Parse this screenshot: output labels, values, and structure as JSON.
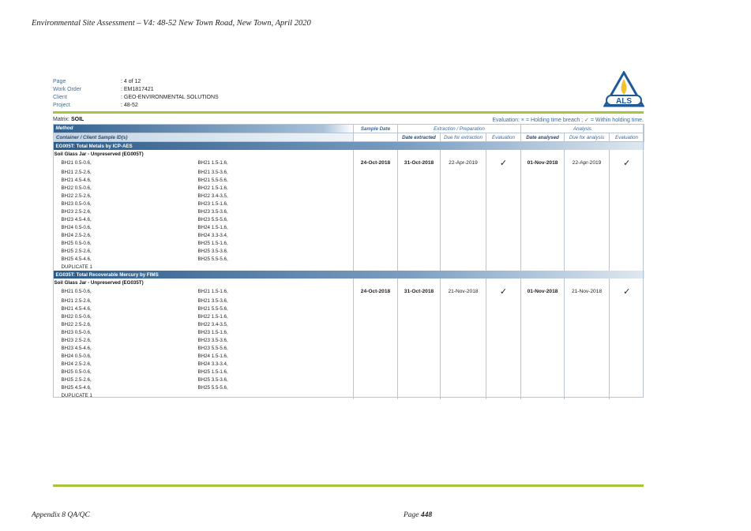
{
  "doc_header": "Environmental Site Assessment – V4: 48-52 New Town Road, New Town, April 2020",
  "meta": [
    {
      "label": "Page",
      "value": ": 4 of 12"
    },
    {
      "label": "Work Order",
      "value": ": EM1817421"
    },
    {
      "label": "Client",
      "value": ": GEO-ENVIRONMENTAL SOLUTIONS"
    },
    {
      "label": "Project",
      "value": ": 48-52"
    }
  ],
  "logo_text": "ALS",
  "matrix_label": "Matrix:",
  "matrix_value": "SOIL",
  "evaluation_legend": "Evaluation: × = Holding time breach ; ✓ = Within holding time.",
  "headers": {
    "method": "Method",
    "sample_date": "Sample Date",
    "extraction_group": "Extraction / Preparation",
    "analysis_group": "Analysis",
    "container": "Container / Client Sample ID(s)",
    "date_extracted": "Date extracted",
    "due_extraction": "Due for extraction",
    "evaluation": "Evaluation",
    "date_analysed": "Date analysed",
    "due_analysis": "Due for analysis",
    "evaluation2": "Evaluation"
  },
  "sections": [
    {
      "method": "EG005T: Total Metals by ICP-AES",
      "container": "Soil Glass Jar - Unpreserved (EG005T)",
      "sample_date": "24-Oct-2018",
      "date_extracted": "31-Oct-2018",
      "due_extraction": "22-Apr-2019",
      "eval_extraction": "✓",
      "date_analysed": "01-Nov-2018",
      "due_analysis": "22-Apr-2019",
      "eval_analysis": "✓",
      "samples": [
        [
          "BH21 0.5-0.6,",
          "BH21 1.5-1.6,"
        ],
        [
          "BH21 2.5-2.6,",
          "BH21 3.5-3.6,"
        ],
        [
          "BH21 4.5-4.6,",
          "BH21 5.5-5.6,"
        ],
        [
          "BH22 0.5-0.6,",
          "BH22 1.5-1.6,"
        ],
        [
          "BH22 2.5-2.6,",
          "BH22 3.4-3.5,"
        ],
        [
          "BH23 0.5-0.6,",
          "BH23 1.5-1.6,"
        ],
        [
          "BH23 2.5-2.6,",
          "BH23 3.5-3.6,"
        ],
        [
          "BH23 4.5-4.6,",
          "BH23 5.5-5.6,"
        ],
        [
          "BH24 0.5-0.6,",
          "BH24 1.5-1.6,"
        ],
        [
          "BH24 2.5-2.6,",
          "BH24 3.3-3.4,"
        ],
        [
          "BH25 0.5-0.6,",
          "BH25 1.5-1.6,"
        ],
        [
          "BH25 2.5-2.6,",
          "BH25 3.5-3.6,"
        ],
        [
          "BH25 4.5-4.6,",
          "BH25 5.5-5.6,"
        ],
        [
          "DUPLICATE 1",
          ""
        ]
      ]
    },
    {
      "method": "EG035T: Total Recoverable Mercury by FIMS",
      "container": "Soil Glass Jar - Unpreserved (EG035T)",
      "sample_date": "24-Oct-2018",
      "date_extracted": "31-Oct-2018",
      "due_extraction": "21-Nov-2018",
      "eval_extraction": "✓",
      "date_analysed": "01-Nov-2018",
      "due_analysis": "21-Nov-2018",
      "eval_analysis": "✓",
      "samples": [
        [
          "BH21 0.5-0.6,",
          "BH21 1.5-1.6,"
        ],
        [
          "BH21 2.5-2.6,",
          "BH21 3.5-3.6,"
        ],
        [
          "BH21 4.5-4.6,",
          "BH21 5.5-5.6,"
        ],
        [
          "BH22 0.5-0.6,",
          "BH22 1.5-1.6,"
        ],
        [
          "BH22 2.5-2.6,",
          "BH22 3.4-3.5,"
        ],
        [
          "BH23 0.5-0.6,",
          "BH23 1.5-1.6,"
        ],
        [
          "BH23 2.5-2.6,",
          "BH23 3.5-3.6,"
        ],
        [
          "BH23 4.5-4.6,",
          "BH23 5.5-5.6,"
        ],
        [
          "BH24 0.5-0.6,",
          "BH24 1.5-1.6,"
        ],
        [
          "BH24 2.5-2.6,",
          "BH24 3.3-3.4,"
        ],
        [
          "BH25 0.5-0.6,",
          "BH25 1.5-1.6,"
        ],
        [
          "BH25 2.5-2.6,",
          "BH25 3.5-3.6,"
        ],
        [
          "BH25 4.5-4.6,",
          "BH25 5.5-5.6,"
        ],
        [
          "DUPLICATE 1",
          ""
        ]
      ]
    }
  ],
  "footer_left": "Appendix 8 QA/QC",
  "footer_page_label": "Page",
  "footer_page_number": "448",
  "colors": {
    "accent_green": "#a8c43a",
    "header_blue": "#2f5f8f",
    "logo_blue": "#1f5a96",
    "logo_flame": "#f2c12e"
  }
}
